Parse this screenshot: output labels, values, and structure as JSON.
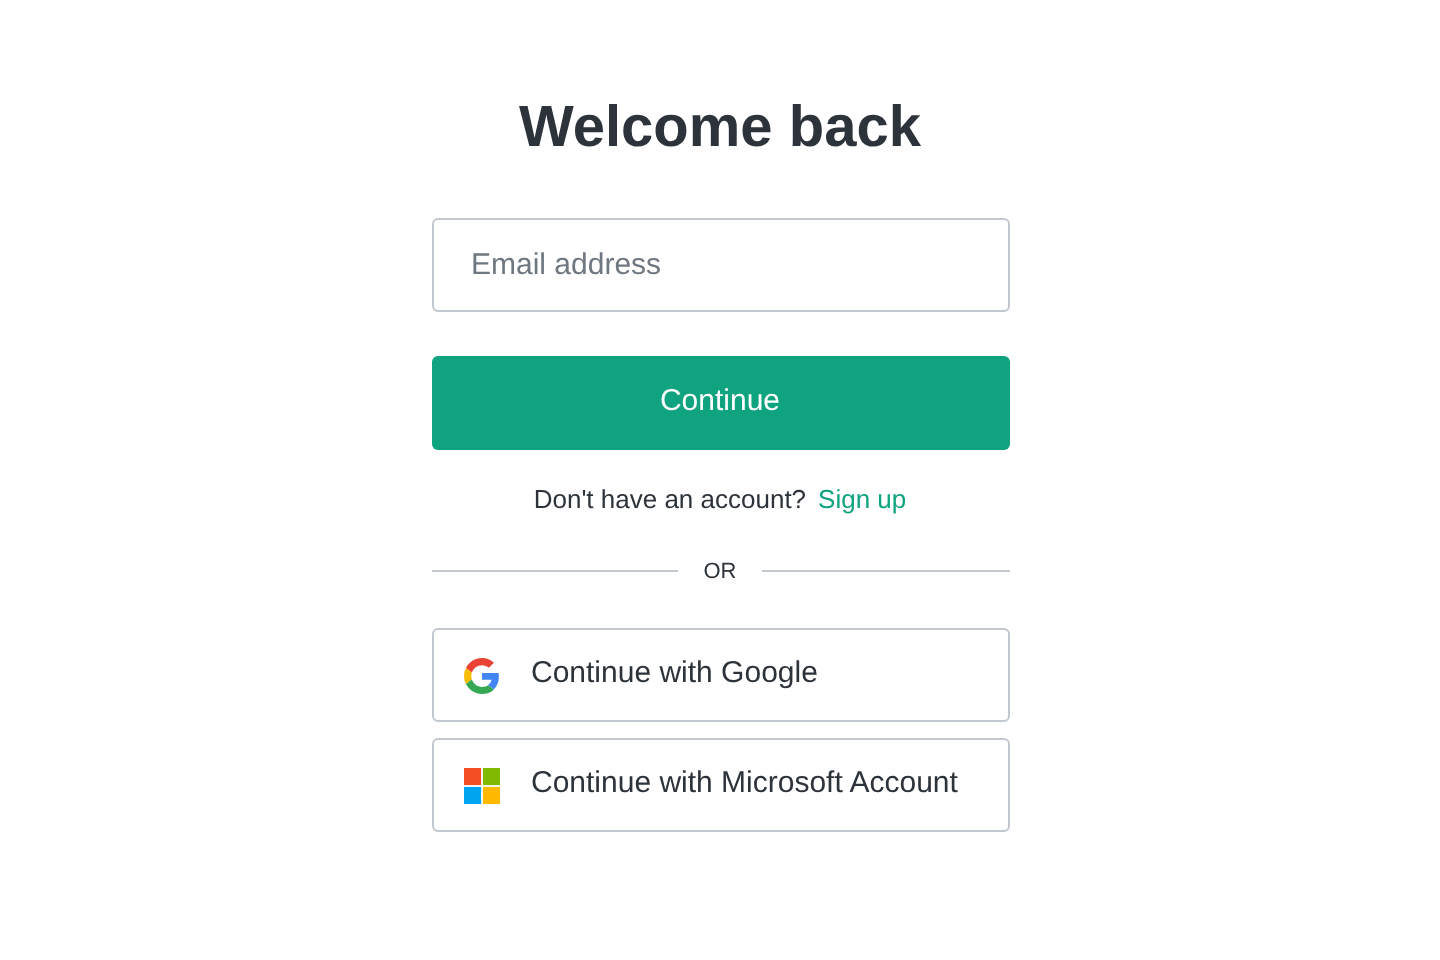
{
  "title": "Welcome back",
  "email_field": {
    "placeholder": "Email address"
  },
  "continue_button": "Continue",
  "signup_prompt": {
    "text": "Don't have an account?",
    "link": "Sign up"
  },
  "divider": "OR",
  "providers": [
    {
      "kind": "google",
      "label": "Continue with Google"
    },
    {
      "kind": "microsoft",
      "label": "Continue with Microsoft Account"
    }
  ]
}
